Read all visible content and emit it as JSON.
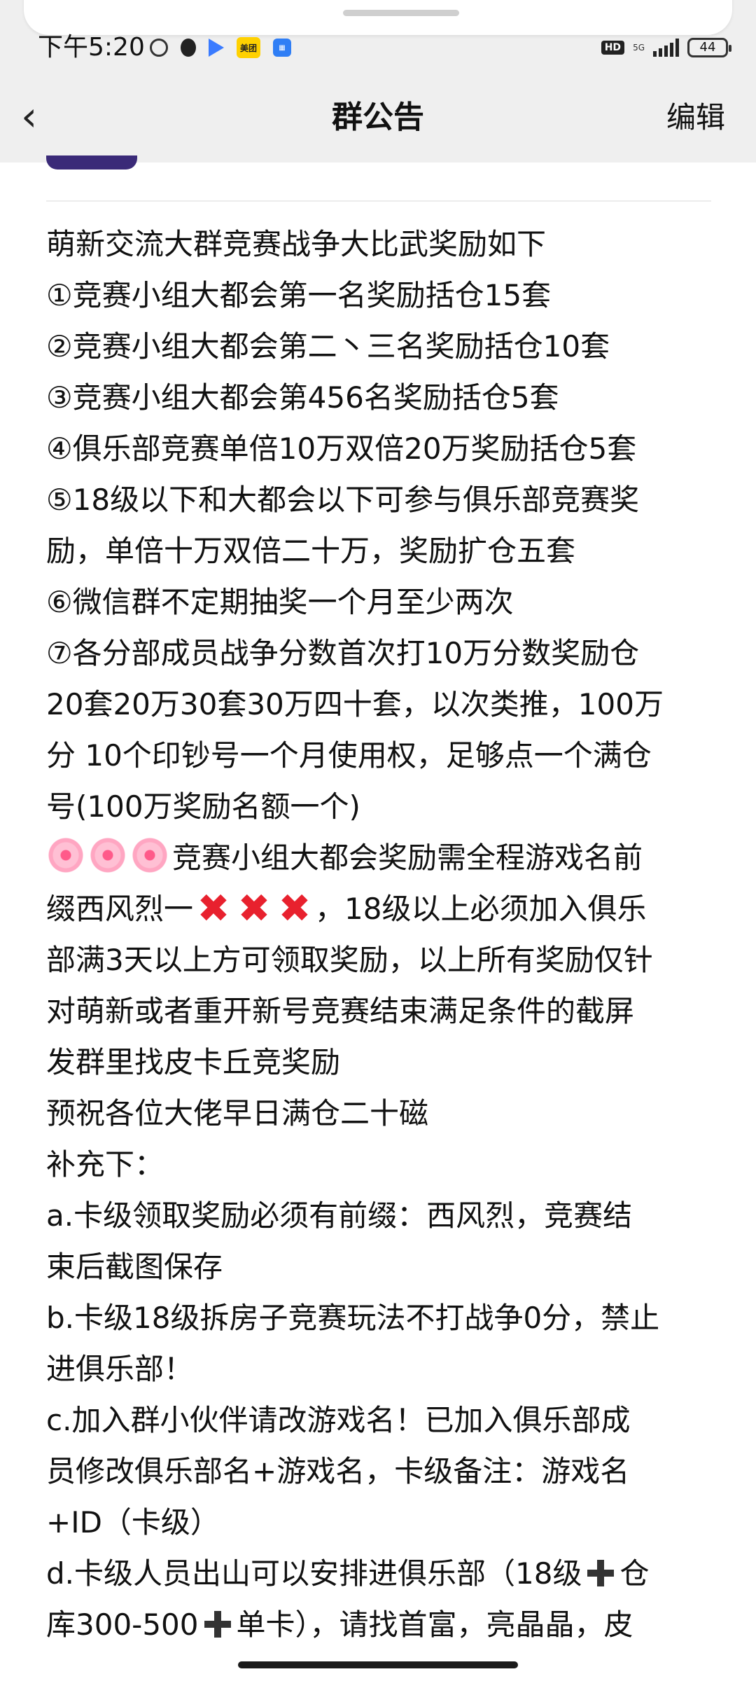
{
  "status_bar": {
    "time": "下午5:20",
    "icons": [
      "alarm-icon",
      "qq-icon",
      "video-play-icon",
      "meituan-icon",
      "app-icon"
    ],
    "meituan_label": "美团",
    "hd_label": "HD",
    "network_label": "5G",
    "battery": "44"
  },
  "nav": {
    "back_icon": "‹",
    "title": "群公告",
    "edit_label": "编辑"
  },
  "announcement": {
    "lines": [
      "萌新交流大群竞赛战争大比武奖励如下",
      "①竞赛小组大都会第一名奖励括仓15套",
      "②竞赛小组大都会第二丶三名奖励括仓10套",
      "③竞赛小组大都会第456名奖励括仓5套",
      "④俱乐部竞赛单倍10万双倍20万奖励括仓5套",
      "⑤18级以下和大都会以下可参与俱乐部竞赛奖",
      "励，单倍十万双倍二十万，奖励扩仓五套",
      "⑥微信群不定期抽奖一个月至少两次",
      "⑦各分部成员战争分数首次打10万分数奖励仓",
      "20套20万30套30万四十套，以次类推，100万",
      "分  10个印钞号一个月使用权，足够点一个满仓",
      "号(100万奖励名额一个)"
    ],
    "flower_line_text": "竞赛小组大都会奖励需全程游戏名前",
    "cross_line_prefix": "缀西风烈一",
    "cross_line_suffix": "，18级以上必须加入俱乐",
    "lines2": [
      "部满3天以上方可领取奖励，以上所有奖励仅针",
      "对萌新或者重开新号竞赛结束满足条件的截屏",
      "发群里找皮卡丘竞奖励",
      "预祝各位大佬早日满仓二十磁",
      "补充下：",
      "a.卡级领取奖励必须有前缀：西风烈，竞赛结",
      "束后截图保存",
      "b.卡级18级拆房子竞赛玩法不打战争0分，禁止",
      "进俱乐部！",
      "c.加入群小伙伴请改游戏名！已加入俱乐部成",
      "员修改俱乐部名+游戏名，卡级备注：游戏名",
      "+ID（卡级）"
    ],
    "plus_line1_a": "d.卡级人员出山可以安排进俱乐部（18级",
    "plus_line1_b": "仓",
    "plus_line2_a": "库300-500",
    "plus_line2_b": "单卡），请找首富，亮晶晶，皮",
    "cross_mark": "✖",
    "cross_color": "#e8212e"
  }
}
